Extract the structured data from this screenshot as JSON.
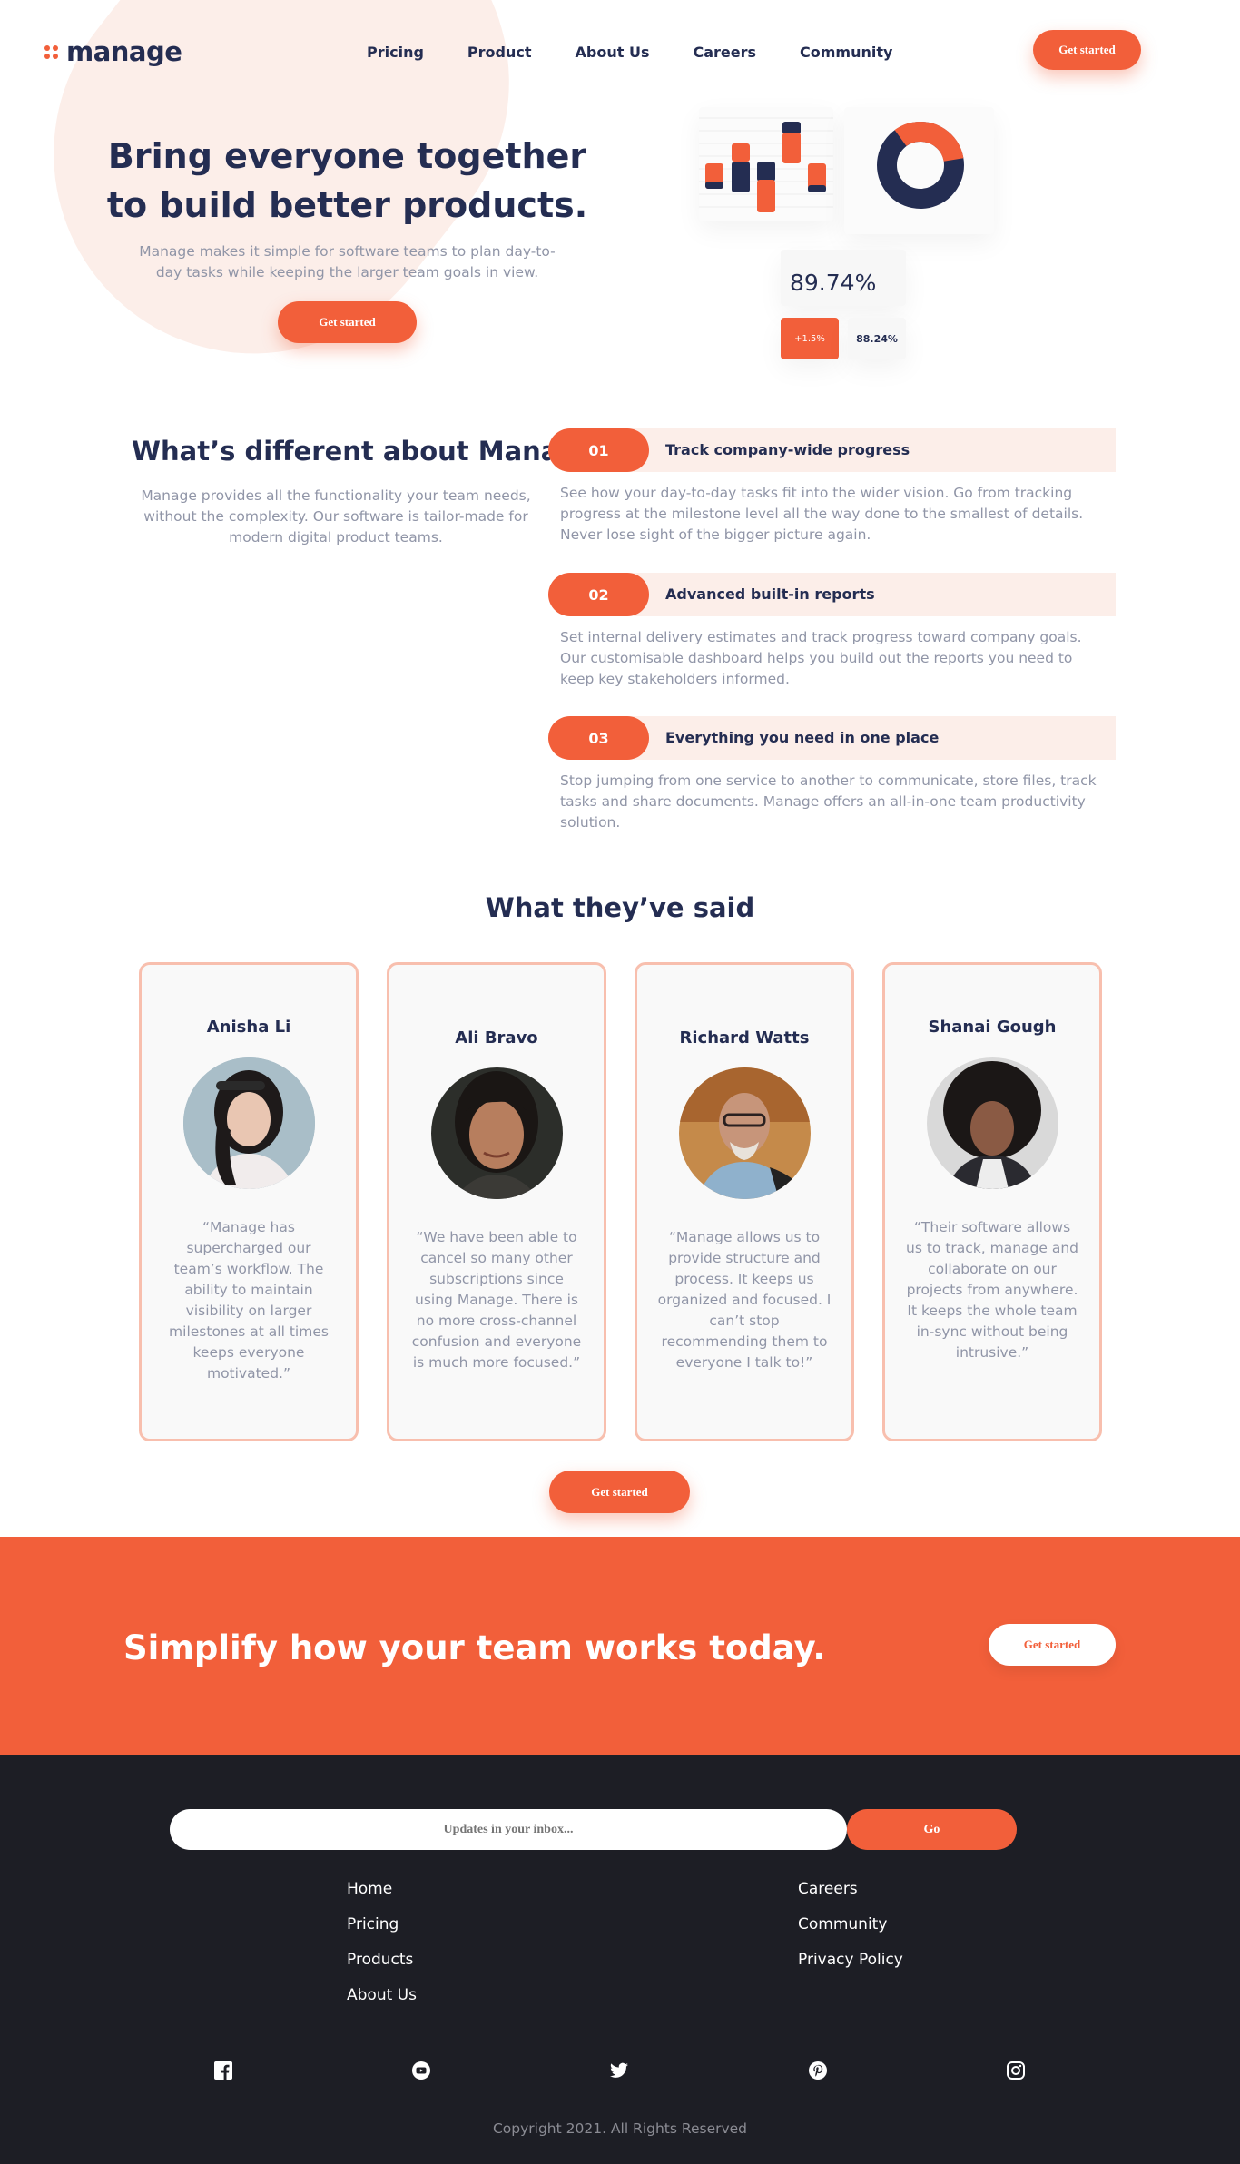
{
  "brand": {
    "name": "manage",
    "accent": "#F25F3A",
    "navy": "#242D52"
  },
  "nav": {
    "links": [
      "Pricing",
      "Product",
      "About Us",
      "Careers",
      "Community"
    ],
    "cta": "Get started"
  },
  "hero": {
    "title": "Bring everyone together to build better products.",
    "subtitle": "Manage makes it simple for software teams to plan day-to-day tasks while keeping the larger team goals in view.",
    "cta": "Get started"
  },
  "dashboard": {
    "main_value": "89.74%",
    "change_value": "+1.5%",
    "secondary_value": "88.24%"
  },
  "different": {
    "title": "What’s different about Manage?",
    "subtitle": "Manage provides all the functionality your team needs, without the complexity. Our software is tailor-made for modern digital product teams.",
    "features": [
      {
        "num": "01",
        "title": "Track company-wide progress",
        "desc": "See how your day-to-day tasks fit into the wider vision. Go from tracking progress at the milestone level all the way done to the smallest of details. Never lose sight of the bigger picture again."
      },
      {
        "num": "02",
        "title": "Advanced built-in reports",
        "desc": "Set internal delivery estimates and track progress toward company goals. Our customisable dashboard helps you build out the reports you need to keep key stakeholders informed."
      },
      {
        "num": "03",
        "title": "Everything you need in one place",
        "desc": "Stop jumping from one service to another to communicate, store files, track tasks and share documents. Manage offers an all-in-one team productivity solution."
      }
    ]
  },
  "testimonials": {
    "title": "What they’ve said",
    "items": [
      {
        "name": "Anisha Li",
        "quote": "“Manage has supercharged our team’s workflow. The ability to maintain visibility on larger milestones at all times keeps everyone motivated.”"
      },
      {
        "name": "Ali Bravo",
        "quote": "“We have been able to cancel so many other subscriptions since using Manage. There is no more cross-channel confusion and everyone is much more focused.”"
      },
      {
        "name": "Richard Watts",
        "quote": "“Manage allows us to provide structure and process. It keeps us organized and focused. I can’t stop recommending them to everyone I talk to!”"
      },
      {
        "name": "Shanai Gough",
        "quote": "“Their software allows us to track, manage and collaborate on our projects from anywhere. It keeps the whole team in-sync without being intrusive.”"
      }
    ],
    "cta": "Get started"
  },
  "cta_band": {
    "title": "Simplify how your team works today.",
    "cta": "Get started"
  },
  "footer": {
    "email_placeholder": "Updates in your inbox...",
    "go": "Go",
    "col1": [
      "Home",
      "Pricing",
      "Products",
      "About Us"
    ],
    "col2": [
      "Careers",
      "Community",
      "Privacy Policy"
    ],
    "socials": [
      "facebook-icon",
      "youtube-icon",
      "twitter-icon",
      "pinterest-icon",
      "instagram-icon"
    ],
    "copyright": "Copyright 2021. All Rights Reserved"
  }
}
